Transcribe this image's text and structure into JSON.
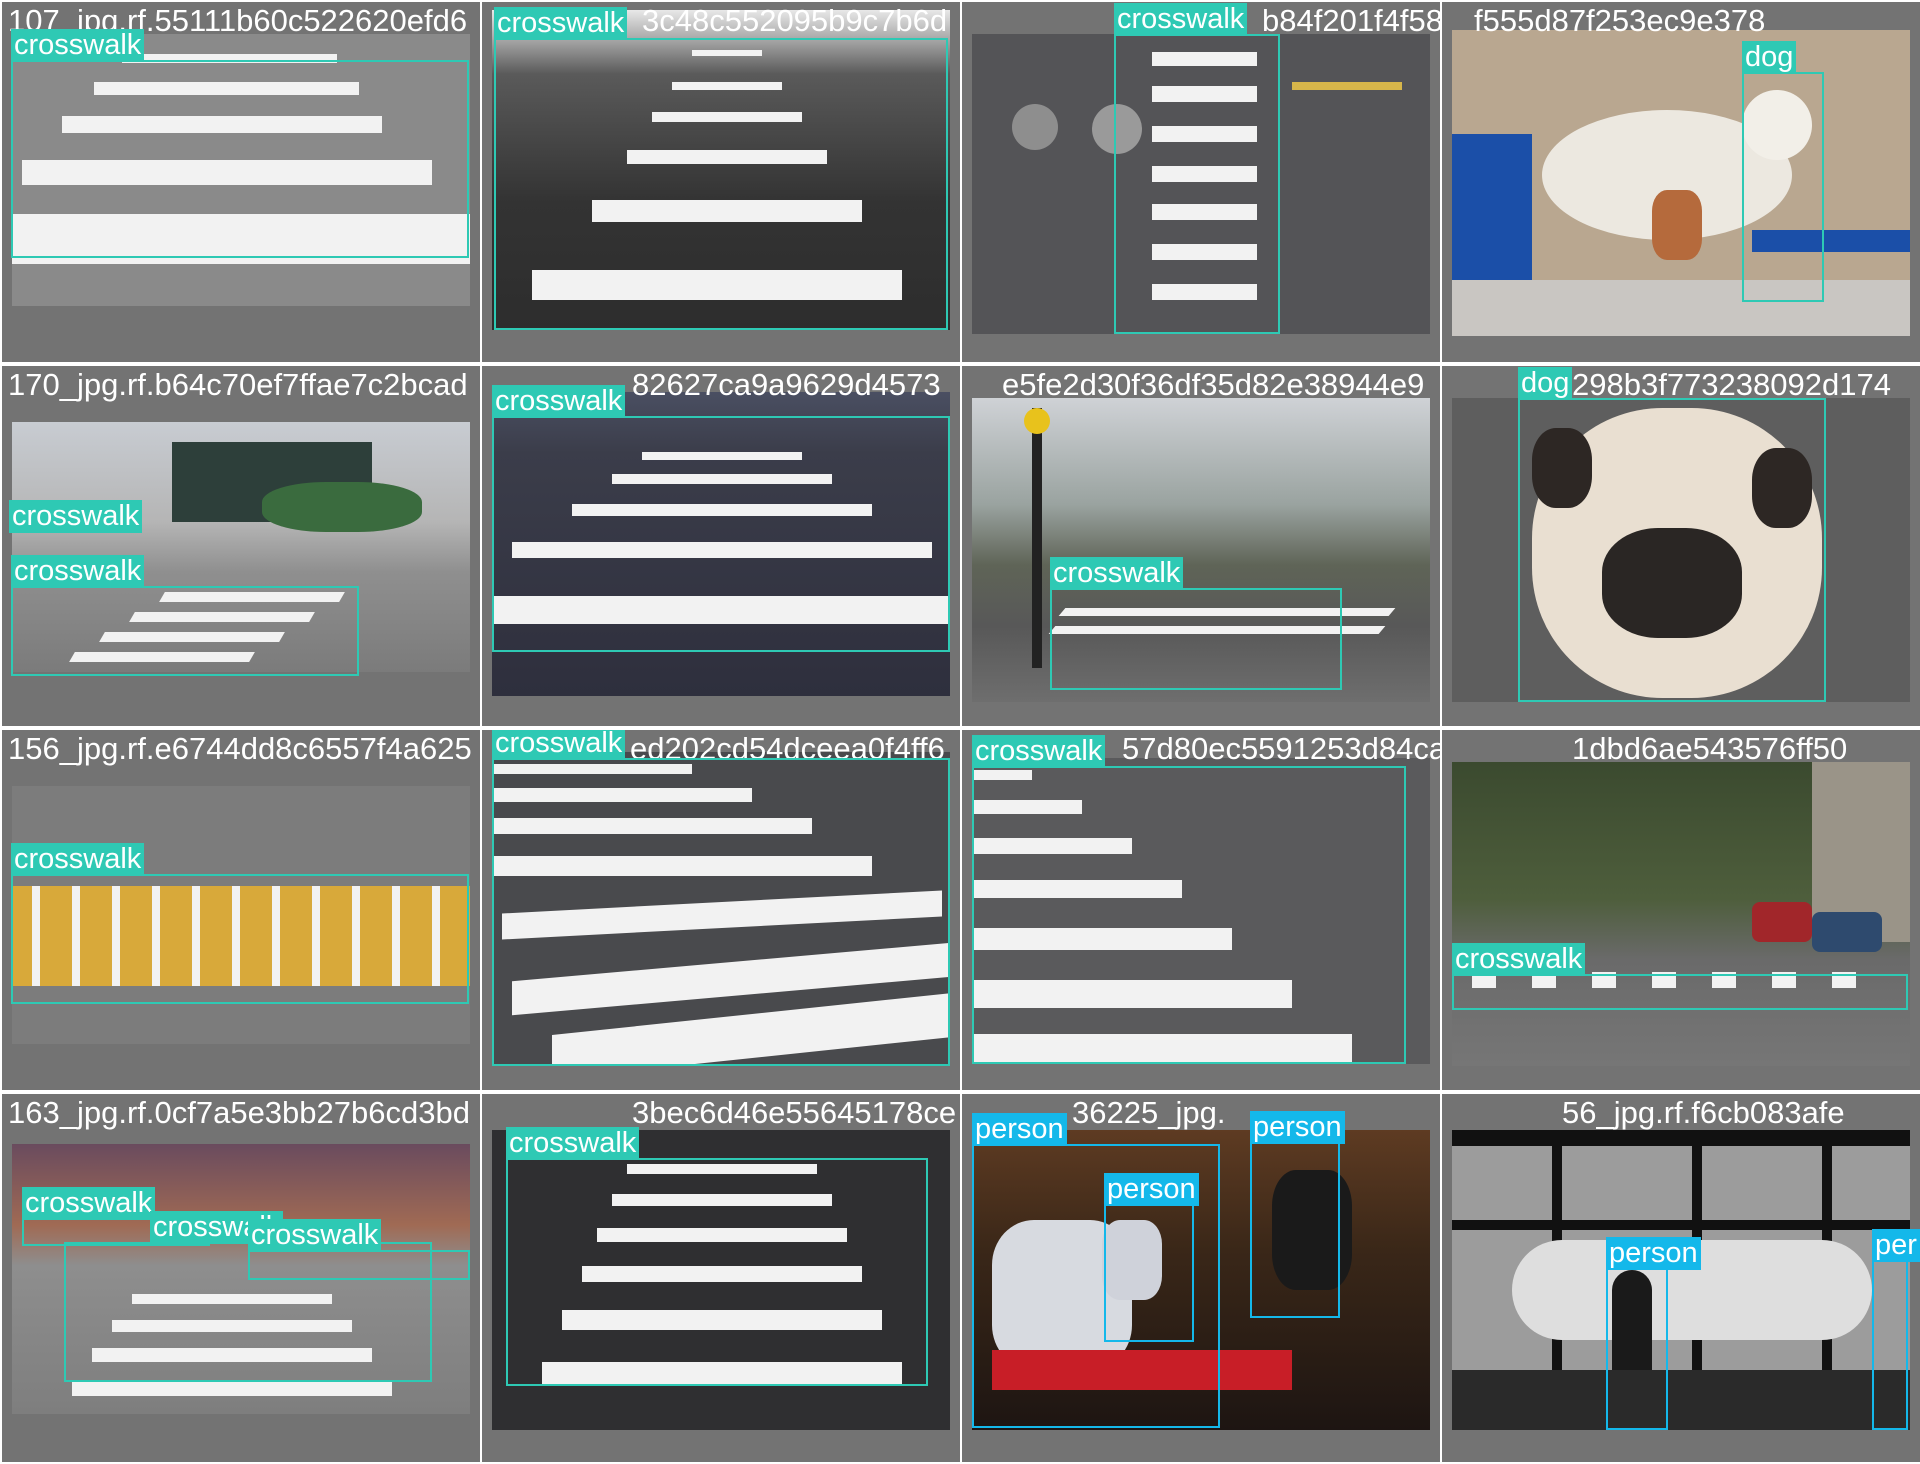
{
  "colors": {
    "crosswalk": "#2ec9b4",
    "dog": "#2ec9b4",
    "person": "#14b8ea",
    "tile_background": "#737373",
    "title_text": "#ffffff"
  },
  "tiles": [
    {
      "title": "107_jpg.rf.55111b60c522620efd6",
      "detections": [
        {
          "label": "crosswalk"
        }
      ]
    },
    {
      "title": "",
      "detections": [
        {
          "label": "crosswalk"
        }
      ],
      "title_fragment": "3c48c552095b9c7b6d"
    },
    {
      "title": "",
      "detections": [
        {
          "label": "crosswalk"
        }
      ],
      "title_fragment": "b84f201f4f58"
    },
    {
      "title": "",
      "detections": [
        {
          "label": "dog"
        }
      ],
      "title_fragment": "f555d87f253ec9e378"
    },
    {
      "title": "170_jpg.rf.b64c70ef7ffae7c2bcad",
      "detections": [
        {
          "label": "crosswalk"
        },
        {
          "label": "crosswalk"
        }
      ]
    },
    {
      "title": "",
      "detections": [
        {
          "label": "crosswalk"
        }
      ],
      "title_fragment": "82627ca9a9629d4573"
    },
    {
      "title": "",
      "detections": [
        {
          "label": "crosswalk"
        }
      ],
      "title_fragment": "e5fe2d30f36df35d82e38944e9"
    },
    {
      "title": "",
      "detections": [
        {
          "label": "dog"
        }
      ],
      "title_fragment": "298b3f773238092d174"
    },
    {
      "title": "156_jpg.rf.e6744dd8c6557f4a625",
      "detections": [
        {
          "label": "crosswalk"
        }
      ]
    },
    {
      "title": "",
      "detections": [
        {
          "label": "crosswalk"
        }
      ],
      "title_fragment": "ed202cd54dceea0f4ff6"
    },
    {
      "title": "",
      "detections": [
        {
          "label": "crosswalk"
        }
      ],
      "title_fragment": "57d80ec5591253d84ca"
    },
    {
      "title": "",
      "detections": [
        {
          "label": "crosswalk"
        }
      ],
      "title_fragment": "1dbd6ae543576ff50"
    },
    {
      "title": "163_jpg.rf.0cf7a5e3bb27b6cd3bd",
      "detections": [
        {
          "label": "crosswalk"
        },
        {
          "label": "crosswalk"
        },
        {
          "label": "crosswalk"
        }
      ]
    },
    {
      "title": "",
      "detections": [
        {
          "label": "crosswalk"
        }
      ],
      "title_fragment": "3bec6d46e55645178ce"
    },
    {
      "title": "",
      "detections": [
        {
          "label": "person"
        },
        {
          "label": "person"
        },
        {
          "label": "person"
        }
      ],
      "title_fragment": "36225_jpg."
    },
    {
      "title": "",
      "detections": [
        {
          "label": "person"
        },
        {
          "label": "per"
        }
      ],
      "title_fragment": "56_jpg.rf.f6cb083afe"
    }
  ]
}
